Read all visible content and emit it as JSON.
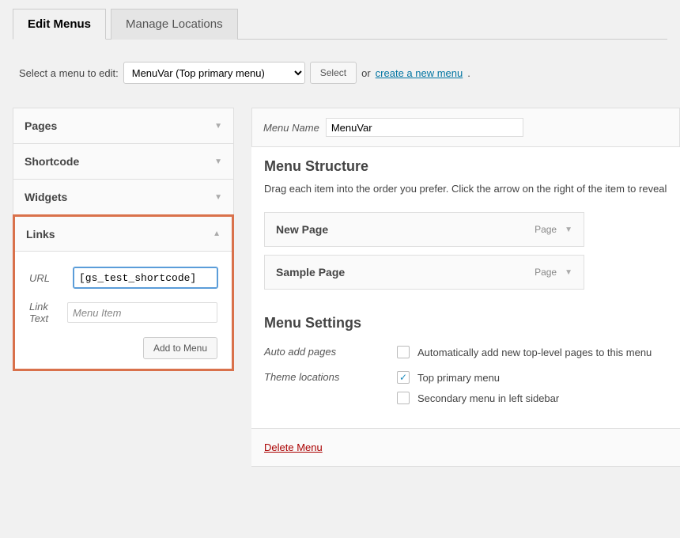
{
  "tabs": {
    "edit": "Edit Menus",
    "locations": "Manage Locations"
  },
  "selector": {
    "label": "Select a menu to edit:",
    "options": [
      "MenuVar (Top primary menu)"
    ],
    "selected": "MenuVar (Top primary menu)",
    "select_btn": "Select",
    "or": "or",
    "create_link": "create a new menu"
  },
  "accordion": {
    "pages": "Pages",
    "shortcode": "Shortcode",
    "widgets": "Widgets",
    "links": {
      "title": "Links",
      "url_label": "URL",
      "url_value": "[gs_test_shortcode]",
      "text_label": "Link Text",
      "text_placeholder": "Menu Item",
      "add_btn": "Add to Menu"
    }
  },
  "right": {
    "menu_name_label": "Menu Name",
    "menu_name_value": "MenuVar",
    "structure_title": "Menu Structure",
    "structure_help": "Drag each item into the order you prefer. Click the arrow on the right of the item to reveal",
    "items": [
      {
        "title": "New Page",
        "type": "Page"
      },
      {
        "title": "Sample Page",
        "type": "Page"
      }
    ],
    "settings_title": "Menu Settings",
    "auto_add_label": "Auto add pages",
    "auto_add_text": "Automatically add new top-level pages to this menu",
    "theme_loc_label": "Theme locations",
    "loc_top": "Top primary menu",
    "loc_secondary": "Secondary menu in left sidebar",
    "delete": "Delete Menu"
  }
}
